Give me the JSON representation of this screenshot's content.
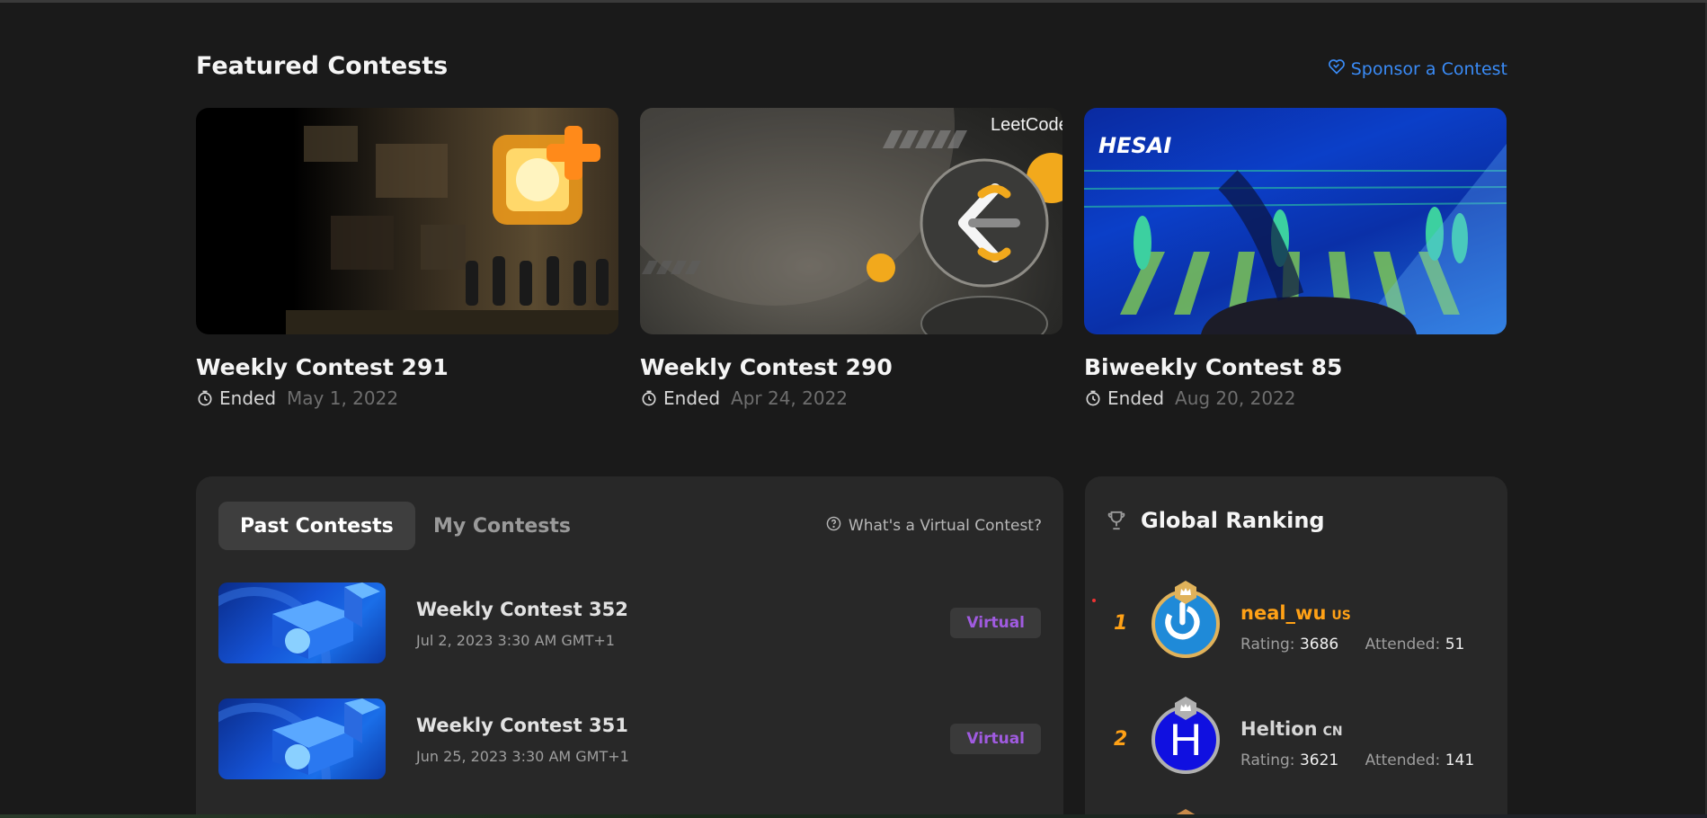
{
  "featured": {
    "title": "Featured Contests",
    "sponsor_label": "Sponsor a Contest",
    "cards": [
      {
        "name": "Weekly Contest 291",
        "status": "Ended",
        "date": "May 1, 2022"
      },
      {
        "name": "Weekly Contest 290",
        "status": "Ended",
        "date": "Apr 24, 2022",
        "banner_text": "LeetCode"
      },
      {
        "name": "Biweekly Contest 85",
        "status": "Ended",
        "date": "Aug 20, 2022",
        "banner_text": "HESAI"
      }
    ]
  },
  "contests_panel": {
    "tabs": [
      {
        "label": "Past Contests",
        "active": true
      },
      {
        "label": "My Contests",
        "active": false
      }
    ],
    "virtual_help": "What's a Virtual Contest?",
    "rows": [
      {
        "name": "Weekly Contest 352",
        "date": "Jul 2, 2023 3:30 AM GMT+1",
        "badge": "Virtual"
      },
      {
        "name": "Weekly Contest 351",
        "date": "Jun 25, 2023 3:30 AM GMT+1",
        "badge": "Virtual"
      }
    ]
  },
  "ranking": {
    "title": "Global Ranking",
    "rating_label": "Rating:",
    "attended_label": "Attended:",
    "users": [
      {
        "rank": "1",
        "username": "neal_wu",
        "country": "US",
        "rating": "3686",
        "attended": "51",
        "name_color": "#ffa116",
        "crown_color": "#e0b25a",
        "avatar_letter": ""
      },
      {
        "rank": "2",
        "username": "Heltion",
        "country": "CN",
        "rating": "3621",
        "attended": "141",
        "name_color": "#d6d6d6",
        "crown_color": "#b0b0b0",
        "avatar_letter": "H"
      }
    ]
  },
  "colors": {
    "accent_orange": "#ffa116",
    "link_blue": "#3a8bf6",
    "virtual_purple": "#a05be0"
  }
}
